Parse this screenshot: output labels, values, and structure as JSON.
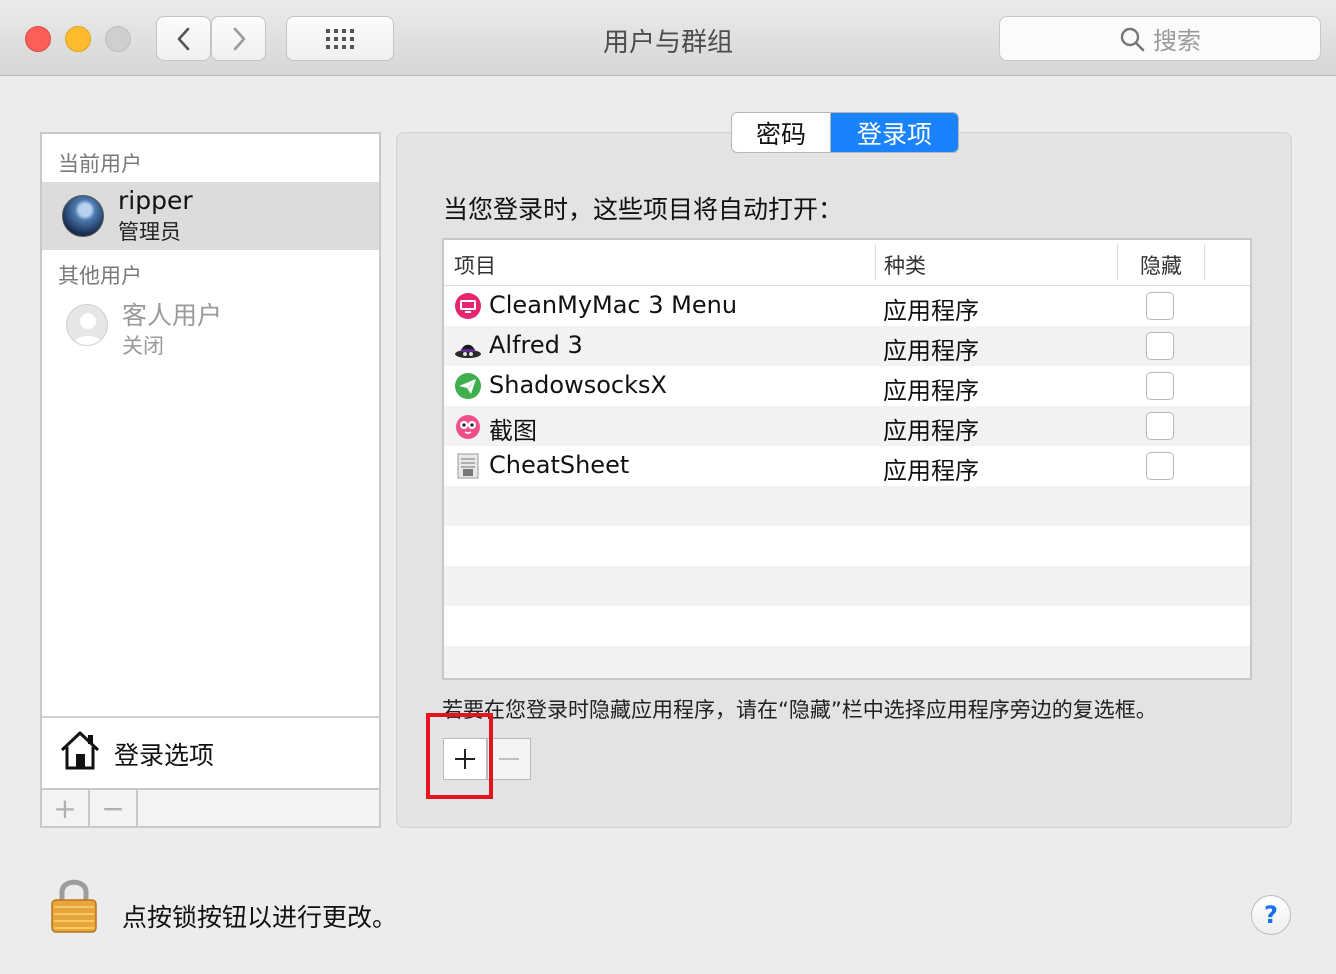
{
  "window": {
    "title": "用户与群组",
    "search_placeholder": "搜索"
  },
  "sidebar": {
    "current_label": "当前用户",
    "current_user": {
      "name": "ripper",
      "role": "管理员"
    },
    "other_label": "其他用户",
    "guest_user": {
      "name": "客人用户",
      "status": "关闭"
    },
    "login_options_label": "登录选项",
    "add_symbol": "+",
    "remove_symbol": "−"
  },
  "tabs": [
    {
      "label": "密码",
      "selected": false
    },
    {
      "label": "登录项",
      "selected": true
    }
  ],
  "login_items": {
    "intro": "当您登录时，这些项目将自动打开：",
    "columns": {
      "item": "项目",
      "kind": "种类",
      "hide": "隐藏"
    },
    "rows": [
      {
        "name": "CleanMyMac 3 Menu",
        "kind": "应用程序",
        "hidden": false,
        "icon": "cleanmymac-icon"
      },
      {
        "name": "Alfred 3",
        "kind": "应用程序",
        "hidden": false,
        "icon": "alfred-icon"
      },
      {
        "name": "ShadowsocksX",
        "kind": "应用程序",
        "hidden": false,
        "icon": "shadowsocks-icon"
      },
      {
        "name": "截图",
        "kind": "应用程序",
        "hidden": false,
        "icon": "screenshot-icon"
      },
      {
        "name": "CheatSheet",
        "kind": "应用程序",
        "hidden": false,
        "icon": "cheatsheet-icon"
      }
    ],
    "hint": "若要在您登录时隐藏应用程序，请在“隐藏”栏中选择应用程序旁边的复选框。"
  },
  "footer": {
    "lock_text": "点按锁按钮以进行更改。",
    "help_label": "?"
  },
  "colors": {
    "accent": "#1a82fb",
    "highlight_box": "#e5131b"
  }
}
